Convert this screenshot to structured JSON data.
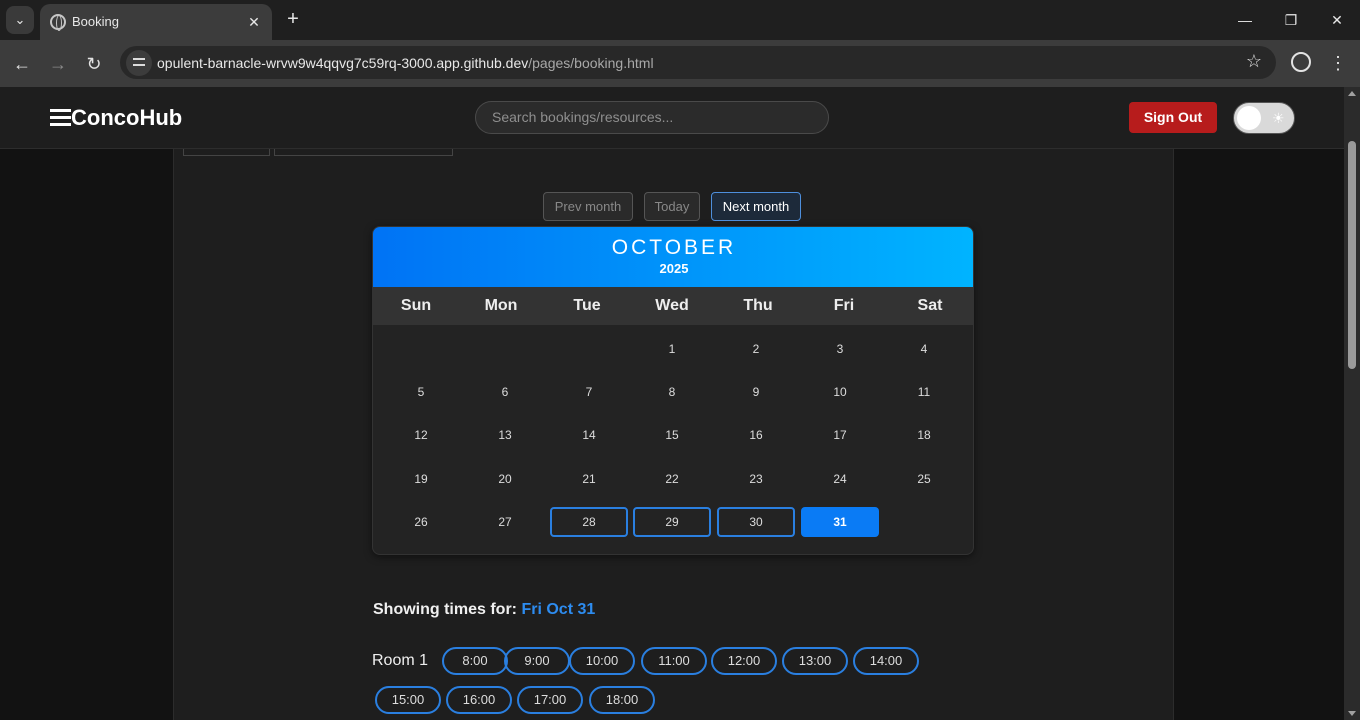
{
  "browser": {
    "tab_title": "Booking",
    "url_host": "opulent-barnacle-wrvw9w4qqvg7c59rq-3000.app.github.dev",
    "url_path": "/pages/booking.html"
  },
  "header": {
    "logo": "ConcoHub",
    "search_placeholder": "Search bookings/resources...",
    "signout_label": "Sign Out"
  },
  "calendar_nav": {
    "prev": "Prev month",
    "today": "Today",
    "next": "Next month"
  },
  "calendar": {
    "month": "OCTOBER",
    "year": "2025",
    "weekdays": [
      "Sun",
      "Mon",
      "Tue",
      "Wed",
      "Thu",
      "Fri",
      "Sat"
    ],
    "first_weekday_index": 3,
    "days_in_month": 31,
    "available_days": [
      28,
      29,
      30
    ],
    "selected_day": 31
  },
  "times": {
    "showing_label": "Showing times for:",
    "selected_date": "Fri Oct 31",
    "room": "Room 1",
    "slots": [
      "8:00",
      "9:00",
      "10:00",
      "11:00",
      "12:00",
      "13:00",
      "14:00",
      "15:00",
      "16:00",
      "17:00",
      "18:00"
    ]
  },
  "colors": {
    "accent": "#0a7bf5",
    "signout": "#b71c1c"
  }
}
